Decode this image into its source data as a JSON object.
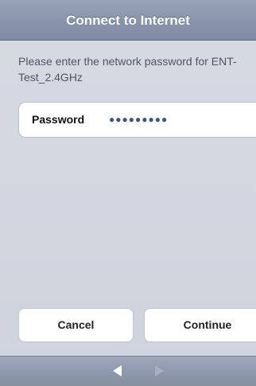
{
  "title_bar": {
    "title": "Connect to Internet"
  },
  "prompt": {
    "text": "Please enter the network password for ENT-Test_2.4GHz"
  },
  "password_field": {
    "label": "Password",
    "value": "●●●●●●●●●"
  },
  "buttons": {
    "cancel_label": "Cancel",
    "continue_label": "Continue"
  },
  "navigation": {
    "back_icon": "left-arrow-icon",
    "forward_icon": "right-arrow-icon",
    "back_enabled": true,
    "forward_enabled": false
  },
  "colors": {
    "title_bar": "#8d97ad",
    "background": "#d2d6df",
    "password_dots": "#40557d"
  }
}
